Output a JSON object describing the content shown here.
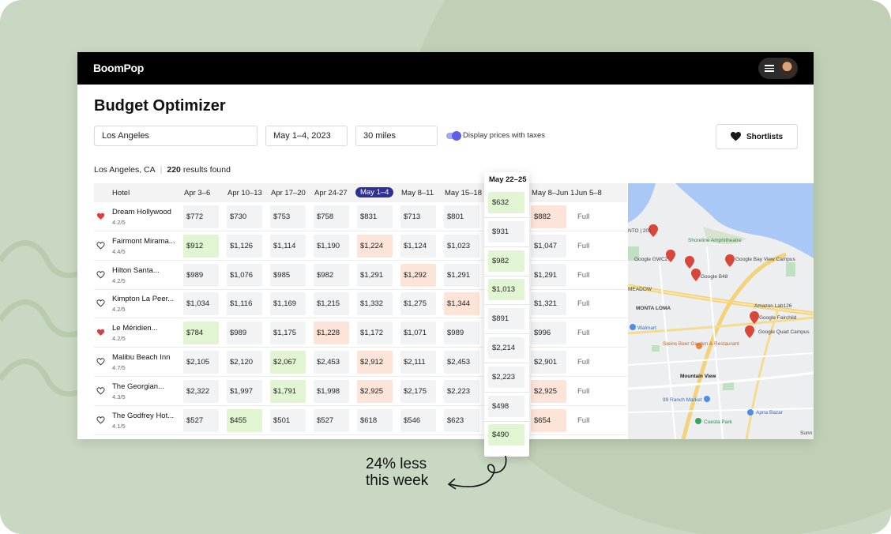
{
  "app": {
    "logo": "BoomPop"
  },
  "page": {
    "title": "Budget Optimizer"
  },
  "filters": {
    "location": "Los Angeles",
    "dates": "May 1–4, 2023",
    "distance": "30 miles",
    "tax_toggle_label": "Display prices with taxes",
    "shortlists_label": "Shortlists"
  },
  "summary": {
    "city": "Los Angeles, CA",
    "count": "220",
    "count_suffix": "results found"
  },
  "table": {
    "hotel_header": "Hotel",
    "columns": [
      "Apr 3–6",
      "Apr 10–13",
      "Apr 17–20",
      "Apr 24-27",
      "May 1–4",
      "May 8–11",
      "May 15–18",
      "",
      "May 8–Jun 1",
      "Jun 5–8"
    ],
    "active_column_index": 4,
    "rows": [
      {
        "name": "Dream Hollywood",
        "rating": "4.2/5",
        "favorite": true,
        "prices": [
          "$772",
          "$730",
          "$753",
          "$758",
          "$831",
          "$713",
          "$801",
          "",
          "$882",
          "Full"
        ],
        "states": [
          "n",
          "n",
          "n",
          "n",
          "n",
          "n",
          "n",
          "",
          "bad",
          "full"
        ]
      },
      {
        "name": "Fairmont Mirama...",
        "rating": "4.4/5",
        "favorite": false,
        "prices": [
          "$912",
          "$1,126",
          "$1,114",
          "$1,190",
          "$1,224",
          "$1,124",
          "$1,023",
          "",
          "$1,047",
          "Full"
        ],
        "states": [
          "good",
          "n",
          "n",
          "n",
          "bad",
          "n",
          "n",
          "",
          "n",
          "full"
        ]
      },
      {
        "name": "Hilton Santa...",
        "rating": "4.2/5",
        "favorite": false,
        "prices": [
          "$989",
          "$1,076",
          "$985",
          "$982",
          "$1,291",
          "$1,292",
          "$1,291",
          "",
          "$1,291",
          "Full"
        ],
        "states": [
          "n",
          "n",
          "n",
          "n",
          "n",
          "bad",
          "n",
          "",
          "n",
          "full"
        ]
      },
      {
        "name": "Kimpton La Peer...",
        "rating": "4.2/5",
        "favorite": false,
        "prices": [
          "$1,034",
          "$1,116",
          "$1,169",
          "$1,215",
          "$1,332",
          "$1,275",
          "$1,344",
          "",
          "$1,321",
          "Full"
        ],
        "states": [
          "n",
          "n",
          "n",
          "n",
          "n",
          "n",
          "bad",
          "",
          "n",
          "full"
        ]
      },
      {
        "name": "Le Méridien...",
        "rating": "4.2/5",
        "favorite": true,
        "prices": [
          "$784",
          "$989",
          "$1,175",
          "$1,228",
          "$1,172",
          "$1,071",
          "$989",
          "",
          "$996",
          "Full"
        ],
        "states": [
          "good",
          "n",
          "n",
          "bad",
          "n",
          "n",
          "n",
          "",
          "n",
          "full"
        ]
      },
      {
        "name": "Malibu Beach Inn",
        "rating": "4.7/5",
        "favorite": false,
        "prices": [
          "$2,105",
          "$2,120",
          "$2,067",
          "$2,453",
          "$2,912",
          "$2,111",
          "$2,453",
          "",
          "$2,901",
          "Full"
        ],
        "states": [
          "n",
          "n",
          "good",
          "n",
          "bad",
          "n",
          "n",
          "",
          "n",
          "full"
        ]
      },
      {
        "name": "The Georgian...",
        "rating": "4.3/5",
        "favorite": false,
        "prices": [
          "$2,322",
          "$1,997",
          "$1,791",
          "$1,998",
          "$2,925",
          "$2,175",
          "$2,223",
          "",
          "$2,925",
          "Full"
        ],
        "states": [
          "n",
          "n",
          "good",
          "n",
          "bad",
          "n",
          "n",
          "",
          "bad",
          "full"
        ]
      },
      {
        "name": "The Godfrey Hot...",
        "rating": "4.1/5",
        "favorite": false,
        "prices": [
          "$527",
          "$455",
          "$501",
          "$527",
          "$618",
          "$546",
          "$623",
          "",
          "$654",
          "Full"
        ],
        "states": [
          "n",
          "good",
          "n",
          "n",
          "n",
          "n",
          "n",
          "",
          "bad",
          "full"
        ]
      }
    ]
  },
  "highlight_column": {
    "header": "May 22–25",
    "prices": [
      "$632",
      "$931",
      "$982",
      "$1,013",
      "$891",
      "$2,214",
      "$2,223",
      "$498",
      "$490"
    ],
    "states": [
      "good",
      "n",
      "good",
      "good",
      "n",
      "n",
      "n",
      "n",
      "good"
    ]
  },
  "map": {
    "labels": [
      "NTO | 201",
      "Shoreline Amphitheatre",
      "Google GWC2",
      "Google Bay View Campus",
      "Google B48",
      "MEADOW",
      "MONTA LOMA",
      "Amazon Lab126",
      "Walmart",
      "Google Fairchild",
      "Google Quad Campus",
      "Steins Beer Garden & Restaurant",
      "Mountain View",
      "99 Ranch Market",
      "Apna Bazar",
      "Cuesta Park",
      "Sunn"
    ]
  },
  "annotation": {
    "line1": "24% less",
    "line2": "this week"
  },
  "colors": {
    "accent": "#2e3192",
    "good": "#e1f5d2",
    "bad": "#fde4d9",
    "favorite": "#e23b3b",
    "toggle": "#5b5fe6"
  }
}
